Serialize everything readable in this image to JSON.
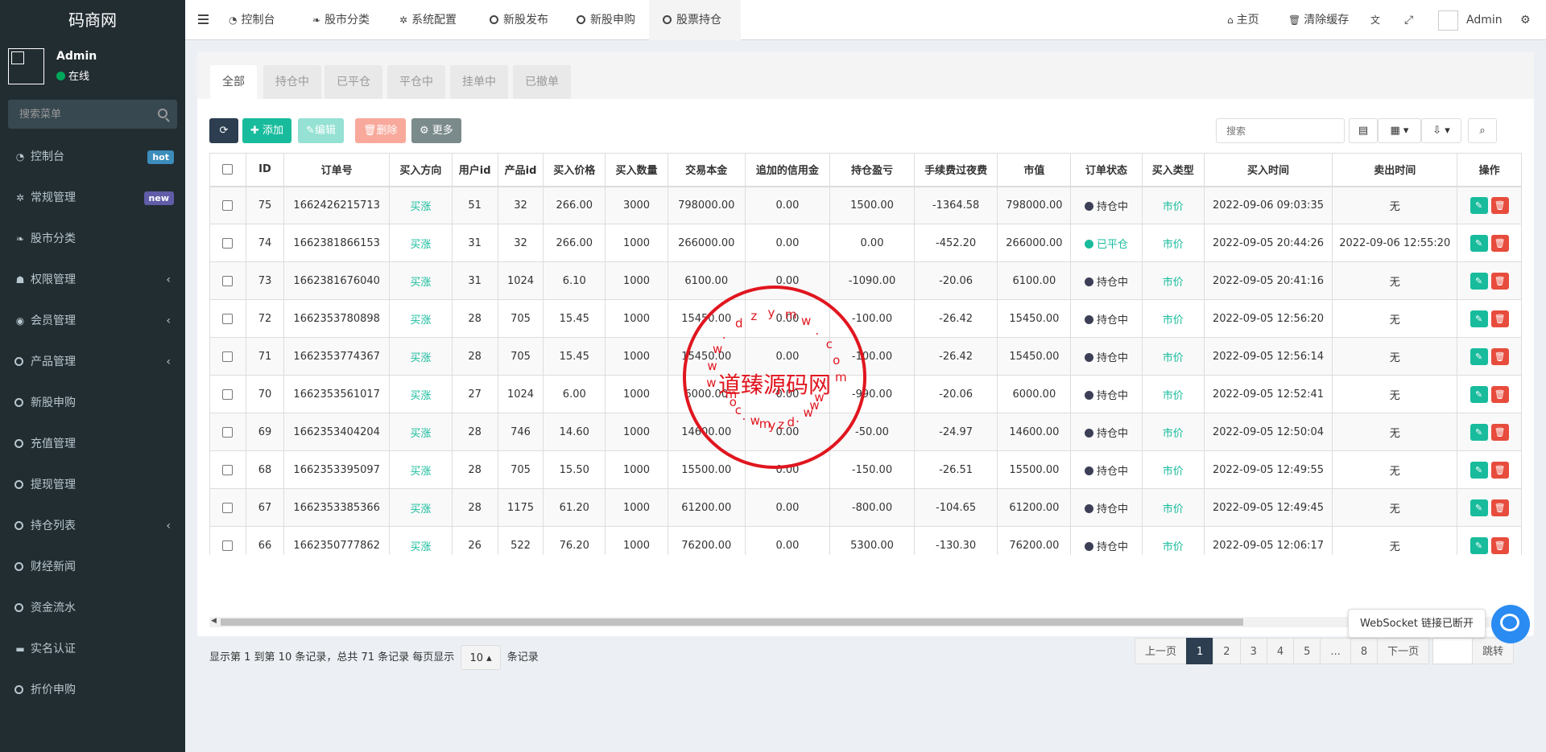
{
  "sidebar": {
    "logo": "码商网",
    "user": {
      "name": "Admin",
      "status": "在线"
    },
    "search_placeholder": "搜索菜单",
    "items": [
      {
        "label": "控制台",
        "icon": "dashboard-icon",
        "badge": "hot"
      },
      {
        "label": "常规管理",
        "icon": "cogs-icon",
        "badge": "new"
      },
      {
        "label": "股市分类",
        "icon": "leaf-icon"
      },
      {
        "label": "权限管理",
        "icon": "group-icon",
        "chevron": true
      },
      {
        "label": "会员管理",
        "icon": "user-circle-icon",
        "chevron": true
      },
      {
        "label": "产品管理",
        "icon": "circle-icon",
        "chevron": true
      },
      {
        "label": "新股申购",
        "icon": "circle-icon"
      },
      {
        "label": "充值管理",
        "icon": "circle-icon"
      },
      {
        "label": "提现管理",
        "icon": "circle-icon"
      },
      {
        "label": "持仓列表",
        "icon": "circle-icon",
        "chevron": true
      },
      {
        "label": "财经新闻",
        "icon": "circle-icon"
      },
      {
        "label": "资金流水",
        "icon": "circle-icon"
      },
      {
        "label": "实名认证",
        "icon": "credit-card-icon"
      },
      {
        "label": "折价申购",
        "icon": "circle-icon"
      }
    ]
  },
  "topbar": {
    "tabs": [
      "控制台",
      "股市分类",
      "系统配置",
      "新股发布",
      "新股申购",
      "股票持仓"
    ],
    "home": "主页",
    "clear_cache": "清除缓存",
    "admin": "Admin"
  },
  "filter_tabs": [
    "全部",
    "持仓中",
    "已平仓",
    "平仓中",
    "挂单中",
    "已撤单"
  ],
  "toolbar": {
    "add": "添加",
    "edit": "编辑",
    "delete": "删除",
    "more": "更多",
    "search_placeholder": "搜索"
  },
  "table": {
    "headers": [
      "ID",
      "订单号",
      "买入方向",
      "用户id",
      "产品id",
      "买入价格",
      "买入数量",
      "交易本金",
      "追加的信用金",
      "持仓盈亏",
      "手续费过夜费",
      "市值",
      "订单状态",
      "买入类型",
      "买入时间",
      "卖出时间",
      "操作"
    ],
    "rows": [
      [
        "75",
        "1662426215713",
        "买涨",
        "51",
        "32",
        "266.00",
        "3000",
        "798000.00",
        "0.00",
        "1500.00",
        "-1364.58",
        "798000.00",
        "持仓中",
        "市价",
        "2022-09-06 09:03:35",
        "无"
      ],
      [
        "74",
        "1662381866153",
        "买涨",
        "31",
        "32",
        "266.00",
        "1000",
        "266000.00",
        "0.00",
        "0.00",
        "-452.20",
        "266000.00",
        "已平仓",
        "市价",
        "2022-09-05 20:44:26",
        "2022-09-06 12:55:20"
      ],
      [
        "73",
        "1662381676040",
        "买涨",
        "31",
        "1024",
        "6.10",
        "1000",
        "6100.00",
        "0.00",
        "-1090.00",
        "-20.06",
        "6100.00",
        "持仓中",
        "市价",
        "2022-09-05 20:41:16",
        "无"
      ],
      [
        "72",
        "1662353780898",
        "买涨",
        "28",
        "705",
        "15.45",
        "1000",
        "15450.00",
        "0.00",
        "-100.00",
        "-26.42",
        "15450.00",
        "持仓中",
        "市价",
        "2022-09-05 12:56:20",
        "无"
      ],
      [
        "71",
        "1662353774367",
        "买涨",
        "28",
        "705",
        "15.45",
        "1000",
        "15450.00",
        "0.00",
        "-100.00",
        "-26.42",
        "15450.00",
        "持仓中",
        "市价",
        "2022-09-05 12:56:14",
        "无"
      ],
      [
        "70",
        "1662353561017",
        "买涨",
        "27",
        "1024",
        "6.00",
        "1000",
        "6000.00",
        "0.00",
        "-990.00",
        "-20.06",
        "6000.00",
        "持仓中",
        "市价",
        "2022-09-05 12:52:41",
        "无"
      ],
      [
        "69",
        "1662353404204",
        "买涨",
        "28",
        "746",
        "14.60",
        "1000",
        "14600.00",
        "0.00",
        "-50.00",
        "-24.97",
        "14600.00",
        "持仓中",
        "市价",
        "2022-09-05 12:50:04",
        "无"
      ],
      [
        "68",
        "1662353395097",
        "买涨",
        "28",
        "705",
        "15.50",
        "1000",
        "15500.00",
        "0.00",
        "-150.00",
        "-26.51",
        "15500.00",
        "持仓中",
        "市价",
        "2022-09-05 12:49:55",
        "无"
      ],
      [
        "67",
        "1662353385366",
        "买涨",
        "28",
        "1175",
        "61.20",
        "1000",
        "61200.00",
        "0.00",
        "-800.00",
        "-104.65",
        "61200.00",
        "持仓中",
        "市价",
        "2022-09-05 12:49:45",
        "无"
      ],
      [
        "66",
        "1662350777862",
        "买涨",
        "26",
        "522",
        "76.20",
        "1000",
        "76200.00",
        "0.00",
        "5300.00",
        "-130.30",
        "76200.00",
        "持仓中",
        "市价",
        "2022-09-05 12:06:17",
        "无"
      ]
    ]
  },
  "pager": {
    "info_prefix": "显示第 1 到第 10 条记录，总共 71 条记录 每页显示",
    "page_size": "10",
    "info_suffix": "条记录",
    "prev": "上一页",
    "pages": [
      "1",
      "2",
      "3",
      "4",
      "5",
      "...",
      "8"
    ],
    "next": "下一页",
    "jump": "跳转"
  },
  "tooltip": "WebSocket 链接已断开",
  "watermark": {
    "center": "道臻源码网",
    "arc_top": "www.dzymw.com",
    "arc_bottom": "www.dzymw.com"
  },
  "colors": {
    "add": "#18bc9c",
    "edit": "#95e1d3",
    "delete": "#f8a99c",
    "more": "#7b8a8b",
    "refresh": "#2c3e50",
    "op_edit": "#18bc9c",
    "op_del": "#e74c3c"
  }
}
